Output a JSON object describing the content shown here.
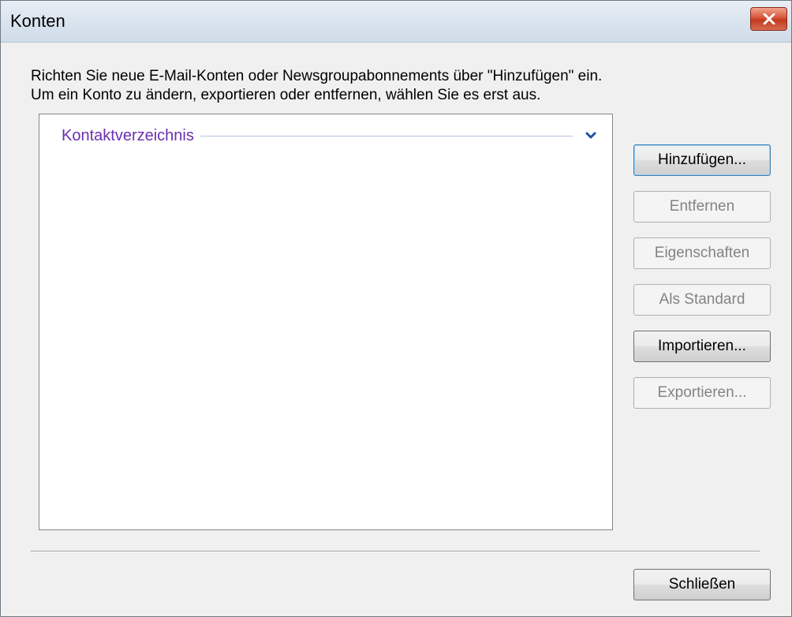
{
  "window": {
    "title": "Konten"
  },
  "description": {
    "line1": "Richten Sie neue E-Mail-Konten oder Newsgroupabonnements über \"Hinzufügen\" ein.",
    "line2": "Um ein Konto zu ändern, exportieren oder entfernen, wählen Sie es erst aus."
  },
  "accounts_list": {
    "groups": [
      {
        "label": "Kontaktverzeichnis",
        "icon": "chevron-down-icon",
        "expanded": true
      }
    ]
  },
  "buttons": {
    "add": "Hinzufügen...",
    "remove": "Entfernen",
    "properties": "Eigenschaften",
    "set_default": "Als Standard",
    "import": "Importieren...",
    "export": "Exportieren...",
    "close": "Schließen"
  },
  "colors": {
    "group_label": "#6a2fb0",
    "close_button": "#c94a30"
  }
}
